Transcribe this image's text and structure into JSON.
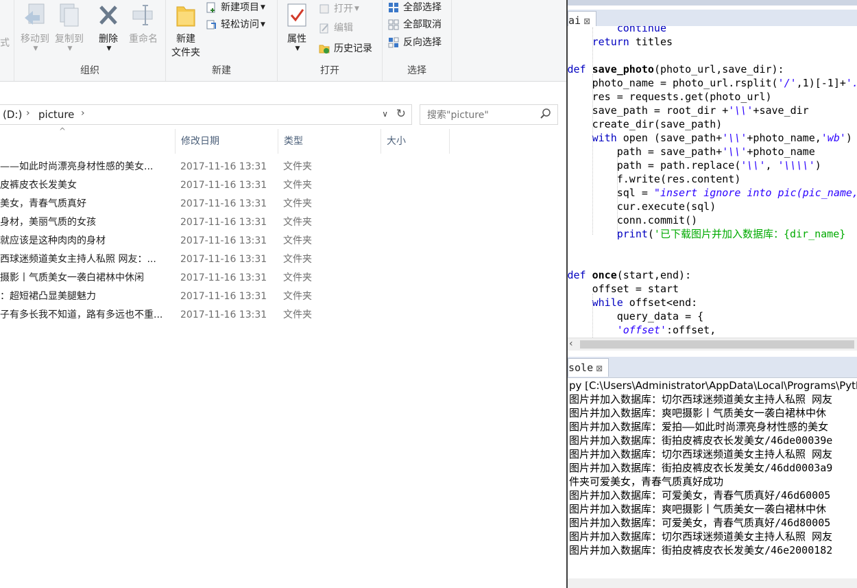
{
  "ribbon": {
    "left_fragment": "式",
    "organize": {
      "title": "组织",
      "move_to": "移动到",
      "copy_to": "复制到",
      "delete": "删除",
      "rename": "重命名"
    },
    "new": {
      "title": "新建",
      "new_folder_line1": "新建",
      "new_folder_line2": "文件夹",
      "new_item": "新建项目",
      "easy_access": "轻松访问"
    },
    "open": {
      "title": "打开",
      "properties": "属性",
      "open": "打开",
      "edit": "编辑",
      "history": "历史记录"
    },
    "select": {
      "title": "选择",
      "select_all": "全部选择",
      "select_none": "全部取消",
      "invert": "反向选择"
    }
  },
  "address": {
    "drive": "(D:)",
    "folder": "picture"
  },
  "search": {
    "placeholder": "搜索\"picture\""
  },
  "columns": {
    "name": "",
    "date": "修改日期",
    "type": "类型",
    "size": "大小"
  },
  "files": [
    {
      "name": "——如此时尚漂亮身材性感的美女...",
      "date": "2017-11-16 13:31",
      "type": "文件夹"
    },
    {
      "name": "皮裤皮衣长发美女",
      "date": "2017-11-16 13:31",
      "type": "文件夹"
    },
    {
      "name": "美女，青春气质真好",
      "date": "2017-11-16 13:31",
      "type": "文件夹"
    },
    {
      "name": "身材，美丽气质的女孩",
      "date": "2017-11-16 13:31",
      "type": "文件夹"
    },
    {
      "name": "就应该是这种肉肉的身材",
      "date": "2017-11-16 13:31",
      "type": "文件夹"
    },
    {
      "name": "西球迷频道美女主持人私照 网友：...",
      "date": "2017-11-16 13:31",
      "type": "文件夹"
    },
    {
      "name": "摄影丨气质美女一袭白裙林中休闲",
      "date": "2017-11-16 13:31",
      "type": "文件夹"
    },
    {
      "name": "：超短裙凸显美腿魅力",
      "date": "2017-11-16 13:31",
      "type": "文件夹"
    },
    {
      "name": "子有多长我不知道，路有多远也不重...",
      "date": "2017-11-16 13:31",
      "type": "文件夹"
    }
  ],
  "ide": {
    "editor_tab": "ai",
    "console_tab": "sole",
    "code": [
      {
        "indent": 8,
        "parts": [
          {
            "t": "continue",
            "c": "kw"
          }
        ]
      },
      {
        "indent": 4,
        "parts": [
          {
            "t": "return",
            "c": "kw"
          },
          {
            "t": " titles",
            "c": ""
          }
        ]
      },
      {
        "indent": 0,
        "parts": []
      },
      {
        "indent": 0,
        "parts": [
          {
            "t": "def",
            "c": "kw"
          },
          {
            "t": " ",
            "c": ""
          },
          {
            "t": "save_photo",
            "c": "fn"
          },
          {
            "t": "(photo_url,save_dir):",
            "c": ""
          }
        ]
      },
      {
        "indent": 4,
        "parts": [
          {
            "t": "photo_name = photo_url.rsplit(",
            "c": ""
          },
          {
            "t": "'/'",
            "c": "str"
          },
          {
            "t": ",1)[-1]+",
            "c": ""
          },
          {
            "t": "'.j",
            "c": "str"
          }
        ]
      },
      {
        "indent": 4,
        "parts": [
          {
            "t": "res = requests.get(photo_url)",
            "c": ""
          }
        ]
      },
      {
        "indent": 4,
        "parts": [
          {
            "t": "save_path = root_dir +",
            "c": ""
          },
          {
            "t": "'\\\\'",
            "c": "str"
          },
          {
            "t": "+save_dir",
            "c": ""
          }
        ]
      },
      {
        "indent": 4,
        "parts": [
          {
            "t": "create_dir(save_path)",
            "c": ""
          }
        ]
      },
      {
        "indent": 4,
        "parts": [
          {
            "t": "with",
            "c": "kw"
          },
          {
            "t": " open (save_path+",
            "c": ""
          },
          {
            "t": "'\\\\'",
            "c": "str"
          },
          {
            "t": "+photo_name,",
            "c": ""
          },
          {
            "t": "'wb'",
            "c": "str"
          },
          {
            "t": ")",
            "c": ""
          }
        ]
      },
      {
        "indent": 8,
        "parts": [
          {
            "t": "path = save_path+",
            "c": ""
          },
          {
            "t": "'\\\\'",
            "c": "str"
          },
          {
            "t": "+photo_name",
            "c": ""
          }
        ]
      },
      {
        "indent": 8,
        "parts": [
          {
            "t": "path = path.replace(",
            "c": ""
          },
          {
            "t": "'\\\\'",
            "c": "str"
          },
          {
            "t": ", ",
            "c": ""
          },
          {
            "t": "'\\\\\\\\'",
            "c": "str"
          },
          {
            "t": ")",
            "c": ""
          }
        ]
      },
      {
        "indent": 8,
        "parts": [
          {
            "t": "f.write(res.content)",
            "c": ""
          }
        ]
      },
      {
        "indent": 8,
        "parts": [
          {
            "t": "sql = ",
            "c": ""
          },
          {
            "t": "\"insert ignore into pic(pic_name,p",
            "c": "str"
          }
        ]
      },
      {
        "indent": 8,
        "parts": [
          {
            "t": "cur.execute(sql)",
            "c": ""
          }
        ]
      },
      {
        "indent": 8,
        "parts": [
          {
            "t": "conn.commit()",
            "c": ""
          }
        ]
      },
      {
        "indent": 8,
        "parts": [
          {
            "t": "print",
            "c": "kw"
          },
          {
            "t": "(",
            "c": ""
          },
          {
            "t": "'已下载图片并加入数据库：{dir_name}",
            "c": "strn"
          }
        ]
      },
      {
        "indent": 0,
        "parts": []
      },
      {
        "indent": 0,
        "parts": []
      },
      {
        "indent": 0,
        "parts": [
          {
            "t": "def",
            "c": "kw"
          },
          {
            "t": " ",
            "c": ""
          },
          {
            "t": "once",
            "c": "fn"
          },
          {
            "t": "(start,end):",
            "c": ""
          }
        ]
      },
      {
        "indent": 4,
        "parts": [
          {
            "t": "offset = start",
            "c": ""
          }
        ]
      },
      {
        "indent": 4,
        "parts": [
          {
            "t": "while",
            "c": "kw"
          },
          {
            "t": " offset<end:",
            "c": ""
          }
        ]
      },
      {
        "indent": 8,
        "parts": [
          {
            "t": "query_data = {",
            "c": ""
          }
        ]
      },
      {
        "indent": 8,
        "parts": [
          {
            "t": "'offset'",
            "c": "str"
          },
          {
            "t": ":offset,",
            "c": ""
          }
        ]
      }
    ],
    "console_path": "py [C:\\Users\\Administrator\\AppData\\Local\\Programs\\Pytho",
    "console_lines": [
      "图片并加入数据库：切尔西球迷频道美女主持人私照 网友",
      "图片并加入数据库：爽吧摄影丨气质美女一袭白裙林中休",
      "图片并加入数据库：爱拍——如此时尚漂亮身材性感的美女",
      "图片并加入数据库：街拍皮裤皮衣长发美女/46de00039e",
      "图片并加入数据库：切尔西球迷频道美女主持人私照 网友",
      "图片并加入数据库：街拍皮裤皮衣长发美女/46dd0003a9",
      "件夹可爱美女，青春气质真好成功",
      "图片并加入数据库：可爱美女，青春气质真好/46d60005",
      "图片并加入数据库：爽吧摄影丨气质美女一袭白裙林中休",
      "图片并加入数据库：可爱美女，青春气质真好/46d80005",
      "图片并加入数据库：切尔西球迷频道美女主持人私照 网友",
      "图片并加入数据库：街拍皮裤皮衣长发美女/46e2000182"
    ]
  }
}
